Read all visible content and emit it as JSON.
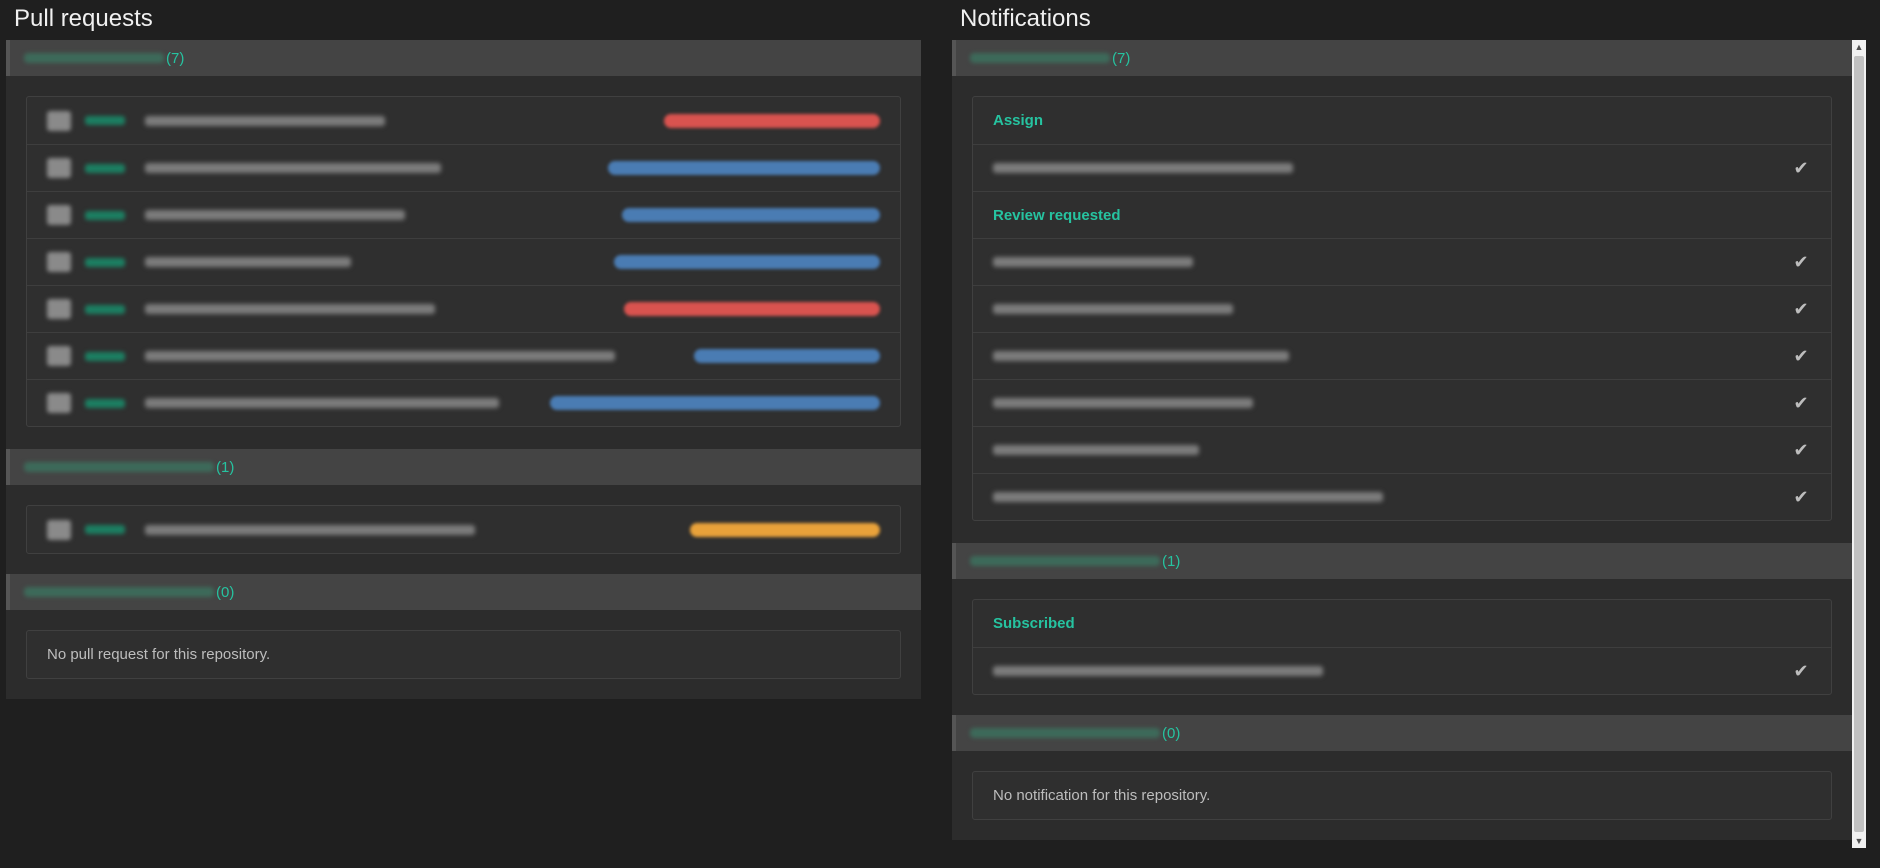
{
  "pull_requests": {
    "title": "Pull requests",
    "groups": [
      {
        "count": "(7)",
        "rows": [
          {
            "title_w": 240,
            "badge": "red",
            "badge_w": 216
          },
          {
            "title_w": 296,
            "badge": "blue",
            "badge_w": 272
          },
          {
            "title_w": 260,
            "badge": "blue",
            "badge_w": 258
          },
          {
            "title_w": 206,
            "badge": "blue",
            "badge_w": 266
          },
          {
            "title_w": 290,
            "badge": "red",
            "badge_w": 256
          },
          {
            "title_w": 470,
            "badge": "blue",
            "badge_w": 186
          },
          {
            "title_w": 354,
            "badge": "blue",
            "badge_w": 330
          }
        ]
      },
      {
        "count": "(1)",
        "rows": [
          {
            "title_w": 330,
            "badge": "orange",
            "badge_w": 190
          }
        ]
      },
      {
        "count": "(0)",
        "empty_text": "No pull request for this repository."
      }
    ]
  },
  "notifications": {
    "title": "Notifications",
    "groups": [
      {
        "count": "(7)",
        "sections": [
          {
            "label": "Assign",
            "rows": [
              {
                "title_w": 300
              }
            ]
          },
          {
            "label": "Review requested",
            "rows": [
              {
                "title_w": 200
              },
              {
                "title_w": 240
              },
              {
                "title_w": 296
              },
              {
                "title_w": 260
              },
              {
                "title_w": 206
              },
              {
                "title_w": 390
              }
            ]
          }
        ]
      },
      {
        "count": "(1)",
        "sections": [
          {
            "label": "Subscribed",
            "rows": [
              {
                "title_w": 330
              }
            ]
          }
        ]
      },
      {
        "count": "(0)",
        "empty_text": "No notification for this repository."
      }
    ]
  },
  "icons": {
    "check": "check-icon",
    "scroll_up": "scroll-up-arrow-icon",
    "scroll_down": "scroll-down-arrow-icon"
  }
}
